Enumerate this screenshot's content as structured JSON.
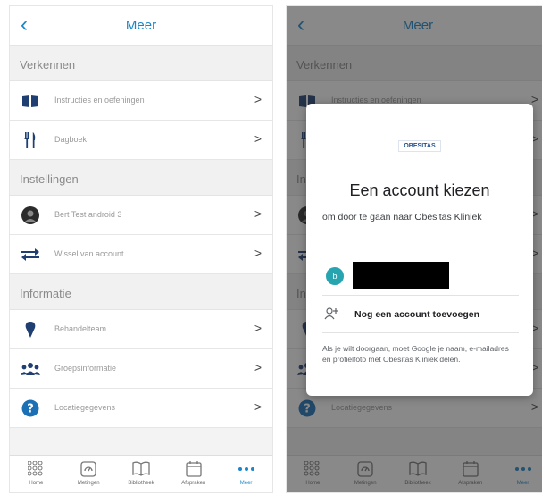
{
  "screen": {
    "title": "Meer",
    "sections": [
      {
        "header": "Verkennen",
        "items": [
          {
            "label": "Instructies en oefeningen",
            "icon": "book-icon"
          },
          {
            "label": "Dagboek",
            "icon": "fork-knife-icon"
          }
        ]
      },
      {
        "header": "Instellingen",
        "items": [
          {
            "label": "Bert Test android 3",
            "icon": "avatar-icon"
          },
          {
            "label": "Wissel van account",
            "icon": "switch-arrows-icon"
          }
        ]
      },
      {
        "header": "Informatie",
        "items": [
          {
            "label": "Behandelteam",
            "icon": "location-pin-icon"
          },
          {
            "label": "Groepsinformatie",
            "icon": "group-icon"
          },
          {
            "label": "Locatiegegevens",
            "icon": "question-circle-icon"
          }
        ]
      }
    ],
    "chevron": ">",
    "tabs": [
      {
        "label": "Home",
        "icon": "grid-icon"
      },
      {
        "label": "Metingen",
        "icon": "gauge-icon"
      },
      {
        "label": "Bibliotheek",
        "icon": "open-book-icon"
      },
      {
        "label": "Afspraken",
        "icon": "calendar-icon"
      },
      {
        "label": "Meer",
        "icon": "more-dots-icon"
      }
    ]
  },
  "dialog": {
    "logo_text": "OBESITAS",
    "title": "Een account kiezen",
    "subtitle": "om door te gaan naar Obesitas Kliniek",
    "account_initial": "b",
    "add_account": "Nog een account toevoegen",
    "consent": "Als je wilt doorgaan, moet Google je naam, e-mailadres en profielfoto met Obesitas Kliniek delen."
  },
  "colors": {
    "accent": "#1a86c9",
    "icon_navy": "#1f3f73",
    "avatar_teal": "#26a4b0"
  }
}
